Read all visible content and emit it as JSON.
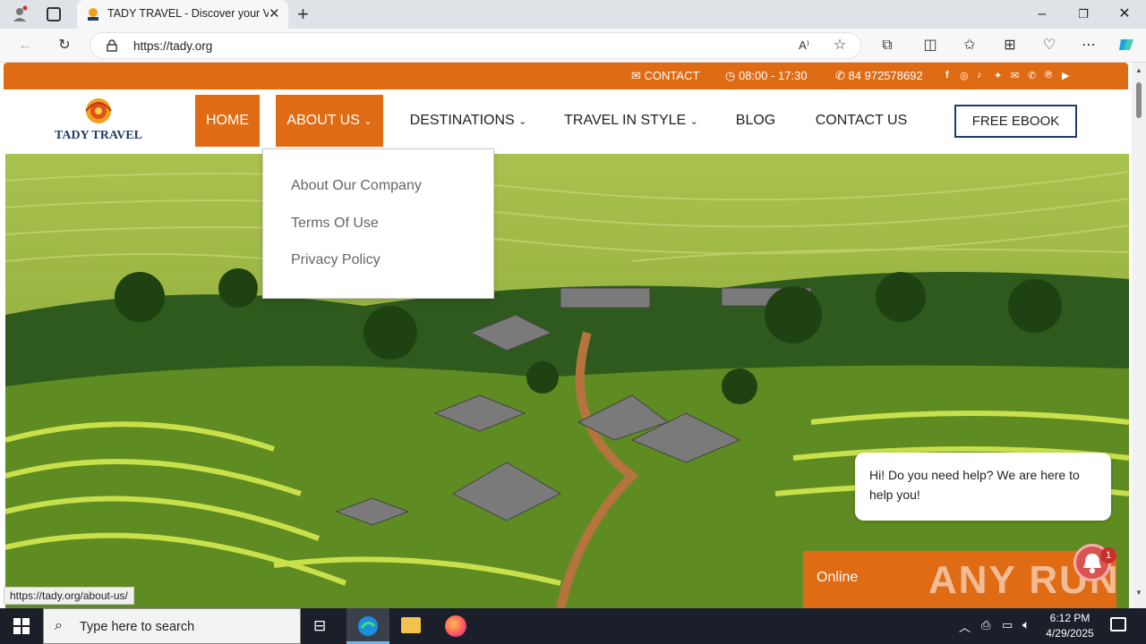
{
  "browser": {
    "tab_title": "TADY TRAVEL - Discover your Vie",
    "url": "https://tady.org",
    "status_url": "https://tady.org/about-us/"
  },
  "topbar": {
    "contact": "CONTACT",
    "hours": "08:00 - 17:30",
    "phone": "84 972578692",
    "socials": [
      "f",
      "◎",
      "♪",
      "✦",
      "✉",
      "✆",
      "℗",
      "▶"
    ]
  },
  "logo": {
    "name": "TADY TRAVEL"
  },
  "nav": {
    "home": "HOME",
    "about": "ABOUT US",
    "destinations": "DESTINATIONS",
    "travel_in_style": "TRAVEL IN STYLE",
    "blog": "BLOG",
    "contact": "CONTACT US",
    "ebook": "FREE EBOOK"
  },
  "dropdown": {
    "items": [
      "About Our Company",
      "Terms Of Use",
      "Privacy Policy"
    ]
  },
  "chat": {
    "message": "Hi! Do you need help? We are here to help you!",
    "status": "Online",
    "badge": "1"
  },
  "watermark": "ANY RUN",
  "taskbar": {
    "search_placeholder": "Type here to search",
    "time": "6:12 PM",
    "date": "4/29/2025"
  },
  "colors": {
    "brand_orange": "#e06b15",
    "brand_navy": "#1d3b6b"
  }
}
